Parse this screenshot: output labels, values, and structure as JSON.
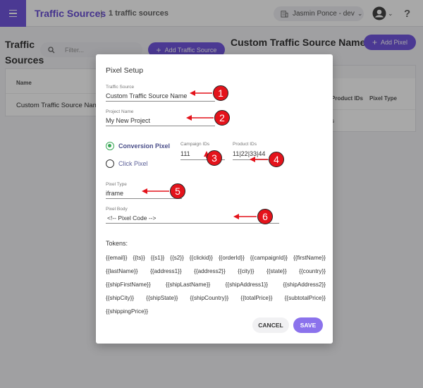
{
  "header": {
    "title": "Traffic Sources",
    "separator": "|",
    "count": "1 traffic sources",
    "account": "Jasmin Ponce - dev",
    "help": "?"
  },
  "left_panel": {
    "title": "Traffic Sources",
    "search_placeholder": "Filter...",
    "add_button": "Add Traffic Source",
    "table_header": "Name",
    "rows": [
      "Custom Traffic Source Name"
    ]
  },
  "right_panel": {
    "title": "Custom Traffic Source Name",
    "add_button": "Add Pixel",
    "headers": [
      "Product IDs",
      "Pixel Type"
    ],
    "cell_fragment": "s"
  },
  "modal": {
    "title": "Pixel Setup",
    "traffic_source": {
      "label": "Traffic Source",
      "value": "Custom Traffic Source Name"
    },
    "project_name": {
      "label": "Project Name",
      "value": "My New Project"
    },
    "conversion_pixel": "Conversion Pixel",
    "click_pixel": "Click Pixel",
    "campaign_ids": {
      "label": "Campaign IDs",
      "value": "111"
    },
    "product_ids": {
      "label": "Product IDs",
      "value": "11|22|33|44"
    },
    "pixel_type": {
      "label": "Pixel Type",
      "value": "iframe"
    },
    "pixel_body": {
      "label": "Pixel Body",
      "value": "<!-- Pixel Code -->"
    },
    "tokens_label": "Tokens:",
    "token_lines": [
      [
        "{{email}}",
        "{{ts}}",
        "{{s1}}",
        "{{s2}}",
        "{{clickid}}",
        "{{orderId}}",
        "{{campaignId}}",
        "{{firstName}}"
      ],
      [
        "{{lastName}}",
        "{{address1}}",
        "{{address2}}",
        "{{city}}",
        "{{state}}",
        "{{country}}"
      ],
      [
        "{{shipFirstName}}",
        "{{shipLastName}}",
        "{{shipAddress1}}",
        "{{shipAddress2}}"
      ],
      [
        "{{shipCity}}",
        "{{shipState}}",
        "{{shipCountry}}",
        "{{totalPrice}}",
        "{{subtotalPrice}}"
      ],
      [
        "{{shippingPrice}}"
      ]
    ],
    "cancel": "CANCEL",
    "save": "SAVE"
  },
  "annotations": [
    "1",
    "2",
    "3",
    "4",
    "5",
    "6"
  ],
  "colors": {
    "accent": "#7357e0",
    "annotation": "#e4131b",
    "radio_on": "#3aa857"
  }
}
